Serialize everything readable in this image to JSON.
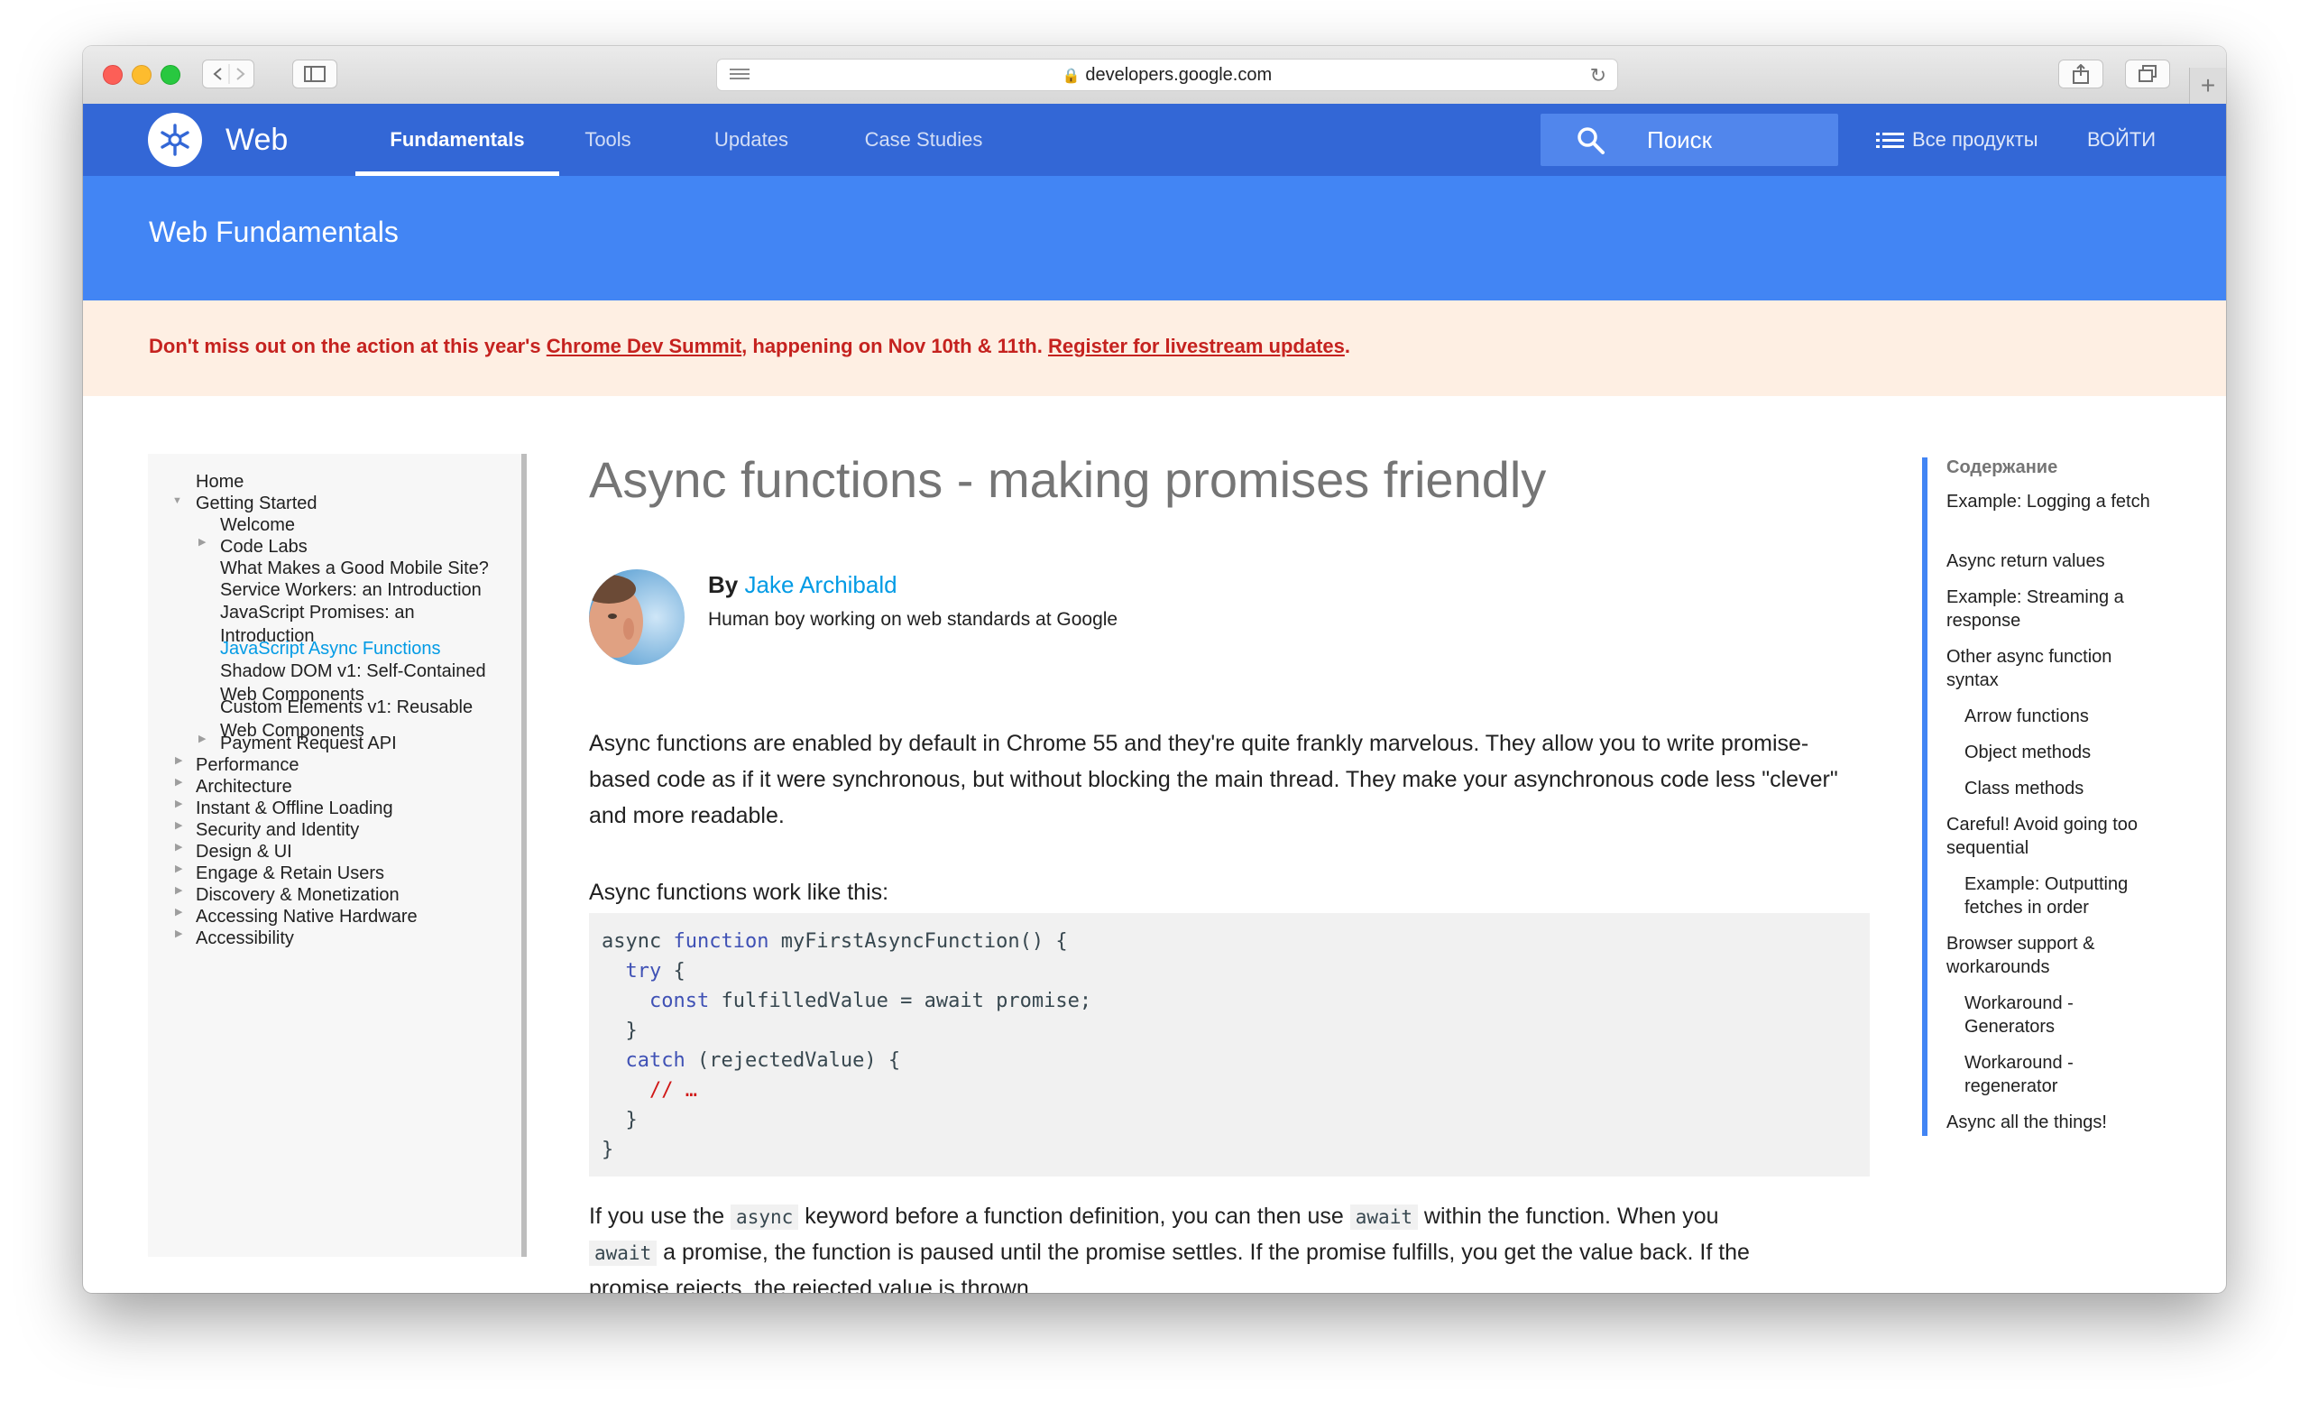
{
  "browser": {
    "url": "developers.google.com"
  },
  "header": {
    "site_title": "Web",
    "tabs": [
      "Fundamentals",
      "Tools",
      "Updates",
      "Case Studies"
    ],
    "search_placeholder": "Поиск",
    "all_products": "Все продукты",
    "login": "ВОЙТИ",
    "accent_color": "#3367d6"
  },
  "hero": {
    "title": "Web Fundamentals"
  },
  "notice": {
    "prefix": "Don't miss out on the action at this year's ",
    "link1": "Chrome Dev Summit",
    "middle": ", happening on Nov 10th & 11th. ",
    "link2": "Register for livestream updates",
    "suffix": "."
  },
  "leftnav": {
    "items": [
      {
        "label": "Home"
      },
      {
        "label": "Getting Started"
      },
      {
        "label": "Welcome"
      },
      {
        "label": "Code Labs"
      },
      {
        "label": "What Makes a Good Mobile Site?"
      },
      {
        "label": "Service Workers: an Introduction"
      },
      {
        "label": "JavaScript Promises: an Introduction"
      },
      {
        "label": "JavaScript Async Functions"
      },
      {
        "label": "Shadow DOM v1: Self-Contained Web Components"
      },
      {
        "label": "Custom Elements v1: Reusable Web Components"
      },
      {
        "label": "Payment Request API"
      },
      {
        "label": "Performance"
      },
      {
        "label": "Architecture"
      },
      {
        "label": "Instant & Offline Loading"
      },
      {
        "label": "Security and Identity"
      },
      {
        "label": "Design & UI"
      },
      {
        "label": "Engage & Retain Users"
      },
      {
        "label": "Discovery & Monetization"
      },
      {
        "label": "Accessing Native Hardware"
      },
      {
        "label": "Accessibility"
      }
    ]
  },
  "article": {
    "title": "Async functions - making promises friendly",
    "by_label": "By",
    "author": "Jake Archibald",
    "bio": "Human boy working on web standards at Google",
    "intro": "Async functions are enabled by default in Chrome 55 and they're quite frankly marvelous. They allow you to write promise-based code as if it were synchronous, but without blocking the main thread. They make your asynchronous code less \"clever\" and more readable.",
    "lead": "Async functions work like this:",
    "code": {
      "l1a": "async ",
      "l1b": "function",
      "l1c": " myFirstAsyncFunction() {",
      "l2a": "  ",
      "l2b": "try",
      "l2c": " {",
      "l3a": "    ",
      "l3b": "const",
      "l3c": " fulfilledValue = await promise;",
      "l4": "  }",
      "l5a": "  ",
      "l5b": "catch",
      "l5c": " (rejectedValue) {",
      "l6a": "    ",
      "l6b": "// …",
      "l7": "  }",
      "l8": "}"
    },
    "p2_a": "If you use the ",
    "p2_code1": "async",
    "p2_b": " keyword before a function definition, you can then use ",
    "p2_code2": "await",
    "p2_c": " within the function. When you",
    "p3_code": "await",
    "p3_a": " a promise, the function is paused until the promise settles. If the promise fulfills, you get the value back. If the",
    "p4": "promise rejects, the rejected value is thrown."
  },
  "toc": {
    "heading": "Содержание",
    "items": [
      "Example: Logging a fetch",
      "Async return values",
      "Example: Streaming a response",
      "Other async function syntax",
      "Arrow functions",
      "Object methods",
      "Class methods",
      "Careful! Avoid going too sequential",
      "Example: Outputting fetches in order",
      "Browser support & workarounds",
      "Workaround - Generators",
      "Workaround - regenerator",
      "Async all the things!"
    ]
  }
}
